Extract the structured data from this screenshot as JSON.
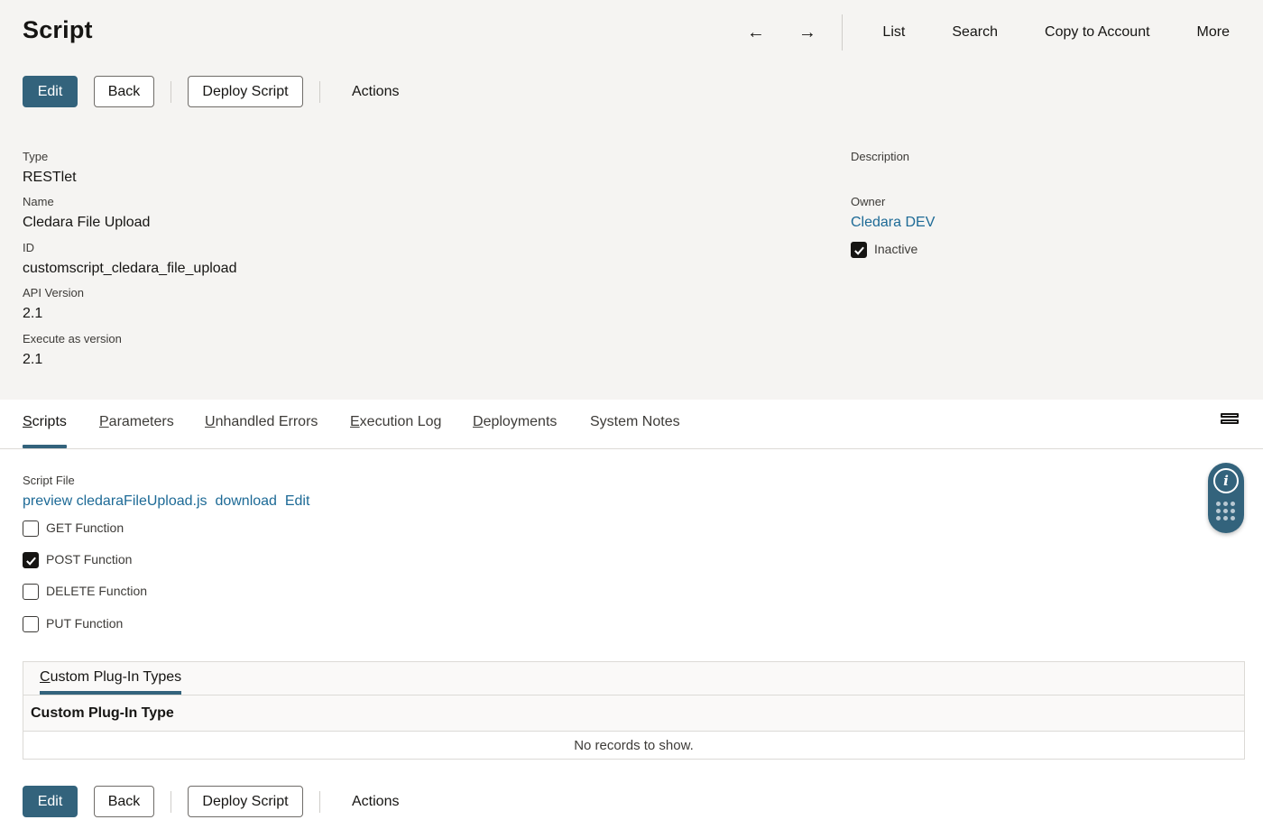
{
  "header": {
    "title": "Script",
    "nav_prev": "←",
    "nav_next": "→",
    "nav_links": [
      "List",
      "Search",
      "Copy to Account",
      "More"
    ]
  },
  "buttons": {
    "edit": "Edit",
    "back": "Back",
    "deploy": "Deploy Script",
    "actions": "Actions"
  },
  "fields": {
    "type_label": "Type",
    "type_value": "RESTlet",
    "name_label": "Name",
    "name_value": "Cledara File Upload",
    "id_label": "ID",
    "id_value": "customscript_cledara_file_upload",
    "api_label": "API Version",
    "api_value": "2.1",
    "exec_label": "Execute as version",
    "exec_value": "2.1",
    "description_label": "Description",
    "owner_label": "Owner",
    "owner_value": "Cledara DEV",
    "inactive_label": "Inactive",
    "inactive_checked": true
  },
  "tabs": [
    "Scripts",
    "Parameters",
    "Unhandled Errors",
    "Execution Log",
    "Deployments",
    "System Notes"
  ],
  "tab_access_keys": [
    "S",
    "P",
    "U",
    "E",
    "D",
    ""
  ],
  "tab_rest": [
    "cripts",
    "arameters",
    "nhandled Errors",
    "xecution Log",
    "eployments",
    "System Notes"
  ],
  "scripts": {
    "file_label": "Script File",
    "preview_link": "preview cledaraFileUpload.js",
    "download_link": "download",
    "edit_link": "Edit",
    "functions": [
      {
        "label": "GET Function",
        "checked": false
      },
      {
        "label": "POST Function",
        "checked": true
      },
      {
        "label": "DELETE Function",
        "checked": false
      },
      {
        "label": "PUT Function",
        "checked": false
      }
    ]
  },
  "sublist": {
    "tab_key": "C",
    "tab_rest": "ustom Plug-In Types",
    "column": "Custom Plug-In Type",
    "empty": "No records to show."
  },
  "colors": {
    "primary": "#33637c",
    "link": "#1d6a96",
    "header_bg": "#f5f4f2"
  }
}
